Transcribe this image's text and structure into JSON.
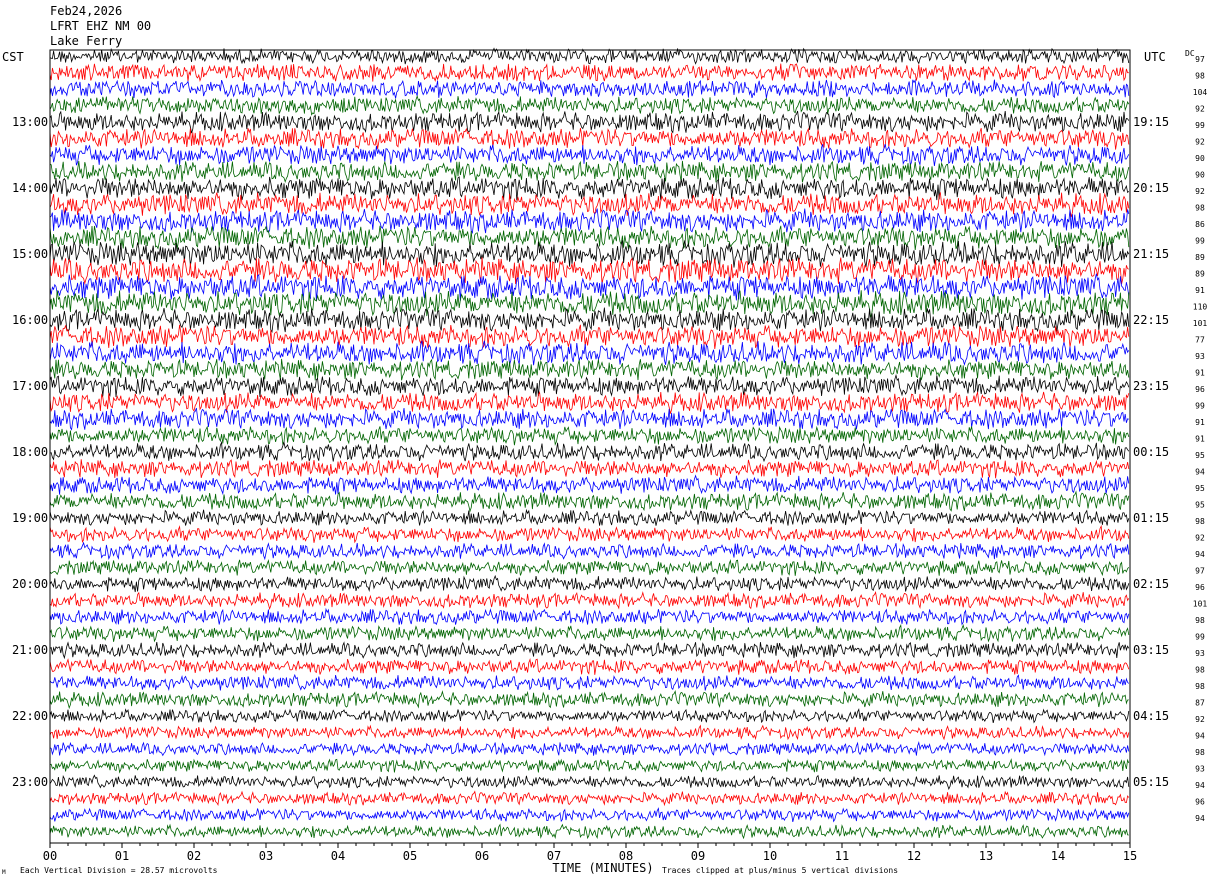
{
  "header": {
    "date": "Feb24,2026",
    "station": "LFRT EHZ NM 00",
    "location": "Lake Ferry"
  },
  "labels": {
    "left_timezone": "CST",
    "right_timezone": "UTC",
    "dc_label": "DC"
  },
  "footer": {
    "vertical_division": "Each Vertical Division =   28.57 microvolts",
    "clip_note": "Traces clipped at plus/minus 5 vertical divisions",
    "corner_mark": "M"
  },
  "chart_data": {
    "type": "helicorder",
    "xlabel": "TIME (MINUTES)",
    "x_ticks": [
      "00",
      "01",
      "02",
      "03",
      "04",
      "05",
      "06",
      "07",
      "08",
      "09",
      "10",
      "11",
      "12",
      "13",
      "14",
      "15"
    ],
    "xlim": [
      0,
      15
    ],
    "row_minutes": 15,
    "rows": 48,
    "trace_colors": [
      "#000000",
      "#ff0000",
      "#0000ff",
      "#006400"
    ],
    "left_hour_labels": [
      "13:00",
      "14:00",
      "15:00",
      "16:00",
      "17:00",
      "18:00",
      "19:00",
      "20:00",
      "21:00",
      "22:00",
      "23:00"
    ],
    "right_hour_labels": [
      "19:15",
      "20:15",
      "21:15",
      "22:15",
      "23:15",
      "00:15",
      "01:15",
      "02:15",
      "03:15",
      "04:15",
      "05:15"
    ],
    "dc_offsets": [
      97,
      98,
      104,
      92,
      99,
      92,
      90,
      90,
      92,
      98,
      86,
      99,
      89,
      89,
      91,
      110,
      101,
      77,
      93,
      91,
      96,
      99,
      91,
      91,
      95,
      94,
      95,
      95,
      98,
      92,
      94,
      97,
      96,
      101,
      98,
      99,
      93,
      98,
      98,
      87,
      92,
      94,
      98,
      93,
      94,
      96,
      94
    ],
    "amplitude_profile": [
      6,
      7,
      7,
      7,
      8,
      8,
      8,
      8,
      9,
      9,
      9,
      9,
      10,
      10,
      10,
      10,
      9,
      9,
      9,
      8,
      8,
      8,
      8,
      7,
      7,
      7,
      7,
      7,
      6,
      6,
      6,
      6,
      6,
      6,
      6,
      6,
      6,
      6,
      6,
      6,
      5,
      5,
      5,
      5,
      5,
      5,
      5,
      5
    ]
  }
}
